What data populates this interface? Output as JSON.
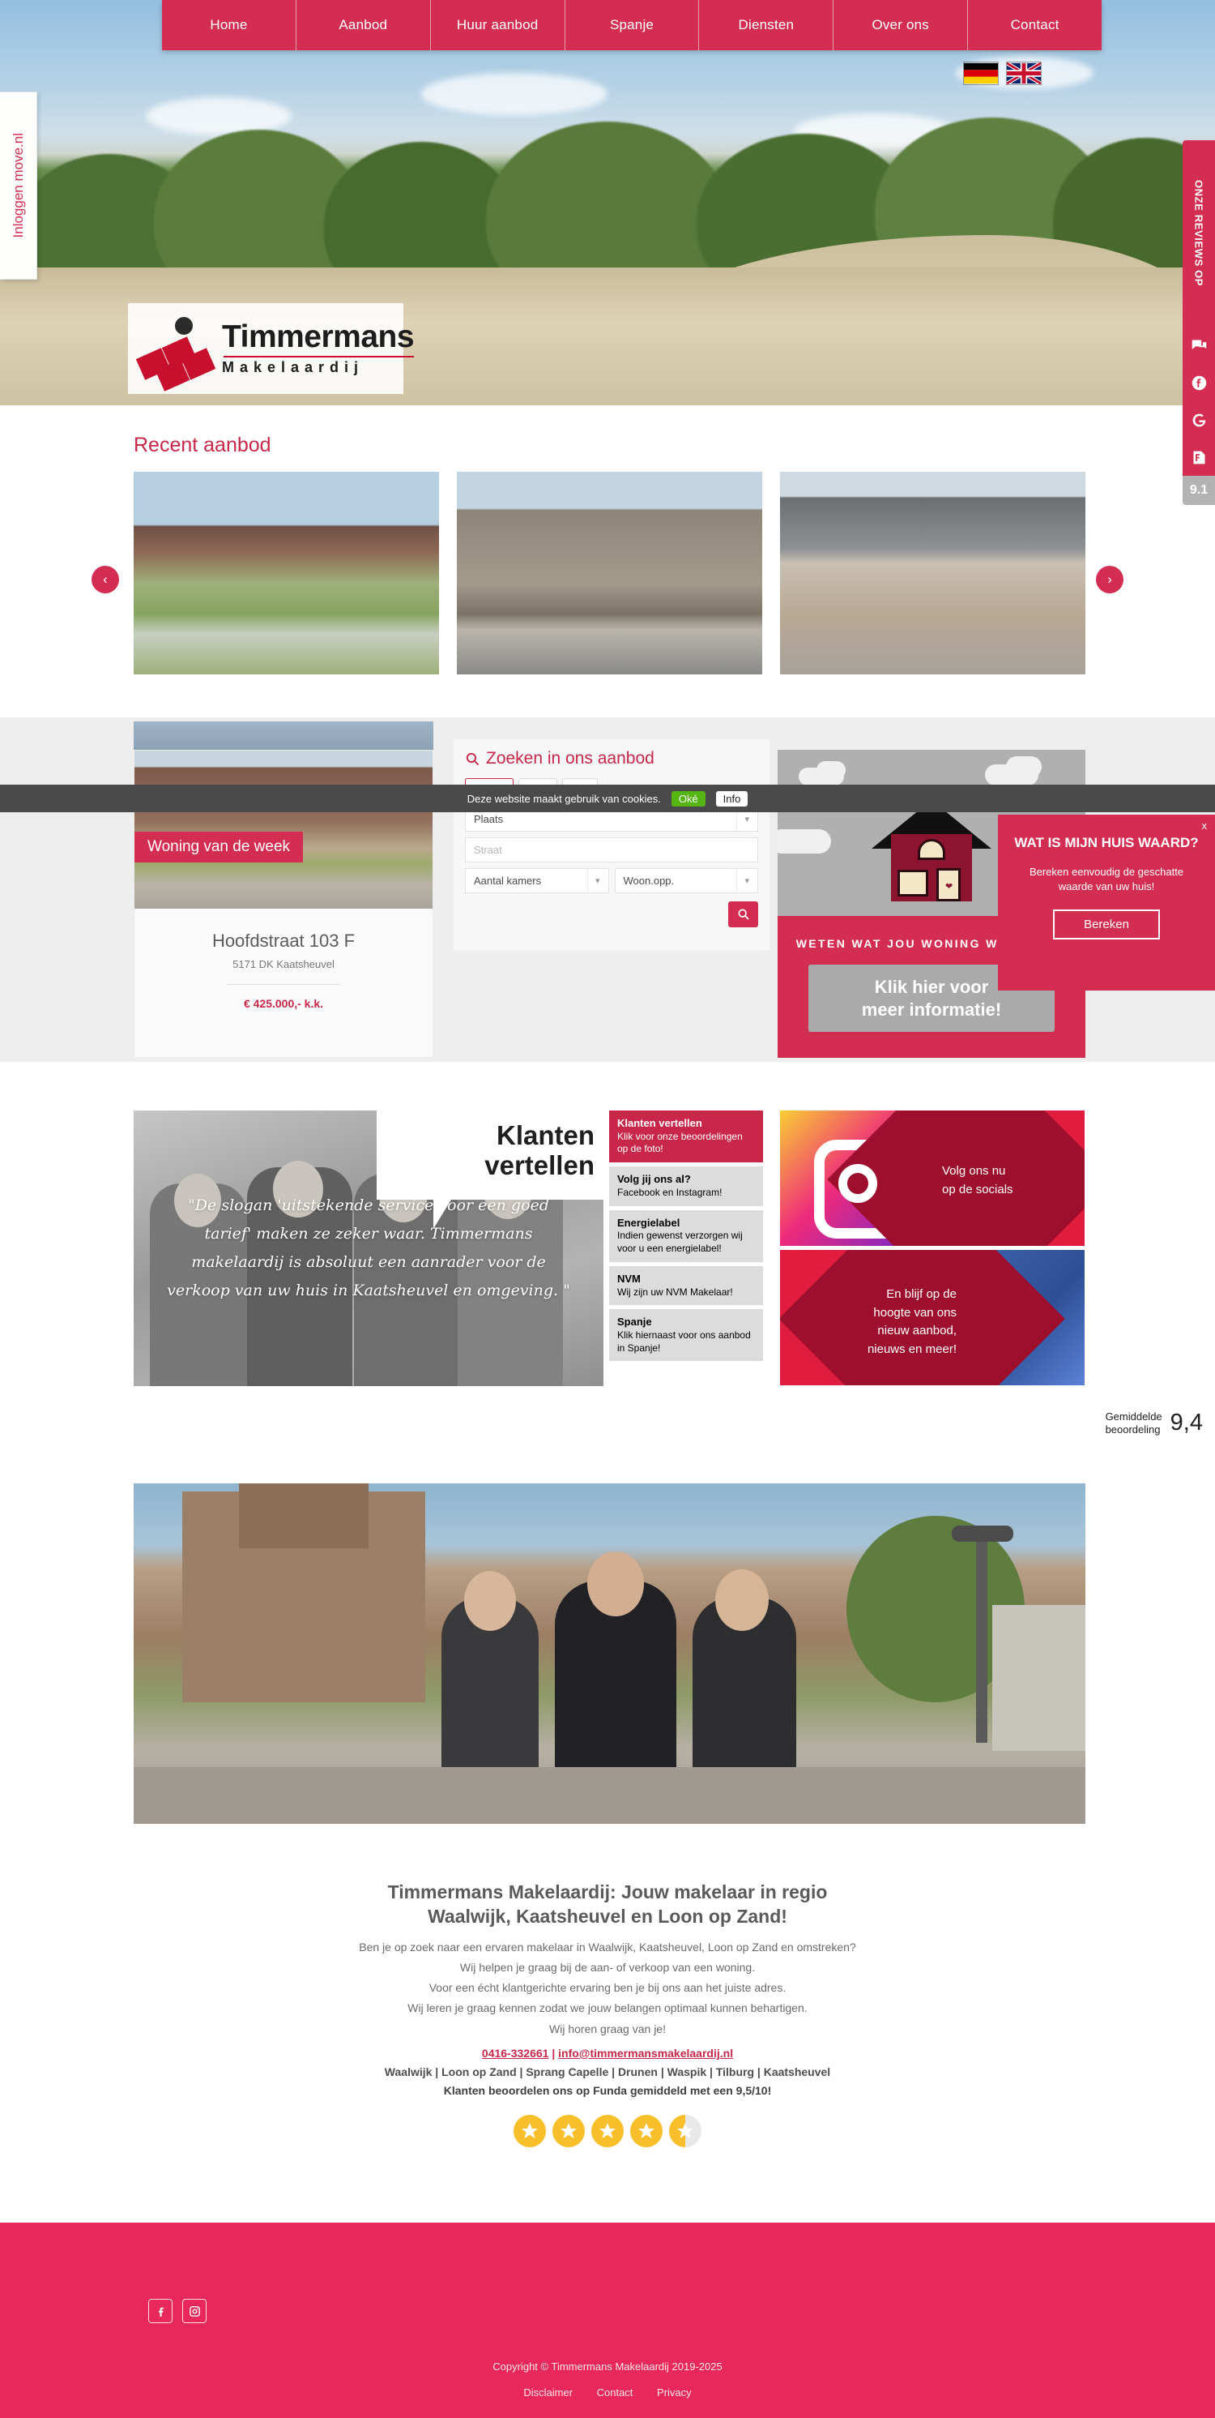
{
  "nav": {
    "items": [
      {
        "label": "Home"
      },
      {
        "label": "Aanbod"
      },
      {
        "label": "Huur aanbod"
      },
      {
        "label": "Spanje"
      },
      {
        "label": "Diensten"
      },
      {
        "label": "Over ons"
      },
      {
        "label": "Contact"
      }
    ]
  },
  "language": {
    "flags": [
      {
        "name": "german-flag",
        "title": "Deutsch"
      },
      {
        "name": "uk-flag",
        "title": "English"
      }
    ]
  },
  "login_tab": {
    "label": "Inloggen move.nl"
  },
  "review_rail": {
    "title": "ONZE REVIEWS OP",
    "icons": [
      "reviews-icon",
      "facebook-icon",
      "google-icon",
      "funda-icon"
    ],
    "score": "9.1"
  },
  "logo": {
    "name": "Timmermans",
    "subtitle": "Makelaardij"
  },
  "recent": {
    "title": "Recent aanbod",
    "prev_label": "‹",
    "next_label": "›"
  },
  "search": {
    "title": "Zoeken in ons aanbod",
    "plaats": "Plaats",
    "straat_placeholder": "Straat",
    "kamers": "Aantal kamers",
    "woonopp": "Woon.opp.",
    "submit_icon": "search-icon"
  },
  "cookies": {
    "text": "Deze website maakt gebruik van cookies.",
    "ok": "Oké",
    "info": "Info"
  },
  "woning_van_de_week": {
    "badge": "Woning van de week",
    "address": "Hoofdstraat 103 F",
    "zip_city": "5171 DK Kaatsheuvel",
    "price": "€ 425.000,- k.k."
  },
  "house_promo": {
    "caption": "WETEN WAT JOU WONING WAARD IS?",
    "button_line1": "Klik hier voor",
    "button_line2": "meer informatie!"
  },
  "waarde_popup": {
    "close": "x",
    "title": "WAT IS MIJN HUIS WAARD?",
    "subtitle": "Bereken eenvoudig de geschatte waarde van uw huis!",
    "button": "Bereken"
  },
  "klanten": {
    "bubble_line1": "Klanten",
    "bubble_line2": "vertellen",
    "quote": "\"De slogan 'uitstekende service voor een goed tarief' maken ze zeker waar. Timmermans makelaardij is absoluut een aanrader voor de verkoop van uw huis in Kaatsheuvel en omgeving. \"",
    "score_label_line1": "Gemiddelde",
    "score_label_line2": "beoordeling",
    "score_value": "9,4",
    "items": [
      {
        "heading": "Klanten vertellen",
        "sub": "Klik voor onze beoordelingen op de foto!",
        "active": true
      },
      {
        "heading": "Volg jij ons al?",
        "sub": "Facebook en Instagram!",
        "active": false
      },
      {
        "heading": "Energielabel",
        "sub": "Indien gewenst verzorgen wij voor u een energielabel!",
        "active": false
      },
      {
        "heading": "NVM",
        "sub": "Wij zijn uw NVM Makelaar!",
        "active": false
      },
      {
        "heading": "Spanje",
        "sub": "Klik hiernaast voor ons aanbod in Spanje!",
        "active": false
      }
    ],
    "social_cards": [
      {
        "text": "Volg ons nu\nop de socials",
        "icon": "instagram-icon"
      },
      {
        "text": "En blijf op de hoogte van ons nieuw aanbod, nieuws en meer!",
        "icon": "facebook-icon"
      }
    ]
  },
  "info": {
    "heading_line1": "Timmermans Makelaardij: Jouw makelaar in regio",
    "heading_line2": "Waalwijk, Kaatsheuvel en Loon op Zand!",
    "paragraphs": [
      "Ben je op zoek naar een ervaren makelaar in Waalwijk, Kaatsheuvel, Loon op Zand en omstreken?",
      "Wij helpen je graag bij de aan- of verkoop van een woning.",
      "Voor een écht klantgerichte ervaring ben je bij ons aan het juiste adres.",
      "Wij leren je graag kennen zodat we jouw belangen optimaal kunnen behartigen.",
      "Wij horen graag van je!"
    ],
    "phone": "0416-332661",
    "separator": "|",
    "email": "info@timmermansmakelaardij.nl",
    "places": "Waalwijk | Loon op Zand | Sprang Capelle | Drunen | Waspik | Tilburg | Kaatsheuvel",
    "funda": "Klanten beoordelen ons op Funda gemiddeld met een 9,5/10!",
    "stars_filled": 4,
    "stars_half": 1,
    "stars_total": 5
  },
  "footer": {
    "socials": [
      "facebook-icon",
      "instagram-icon"
    ],
    "copyright": "Copyright © Timmermans Makelaardij 2019-2025",
    "links": [
      {
        "label": "Disclaimer"
      },
      {
        "label": "Contact"
      },
      {
        "label": "Privacy"
      }
    ]
  }
}
